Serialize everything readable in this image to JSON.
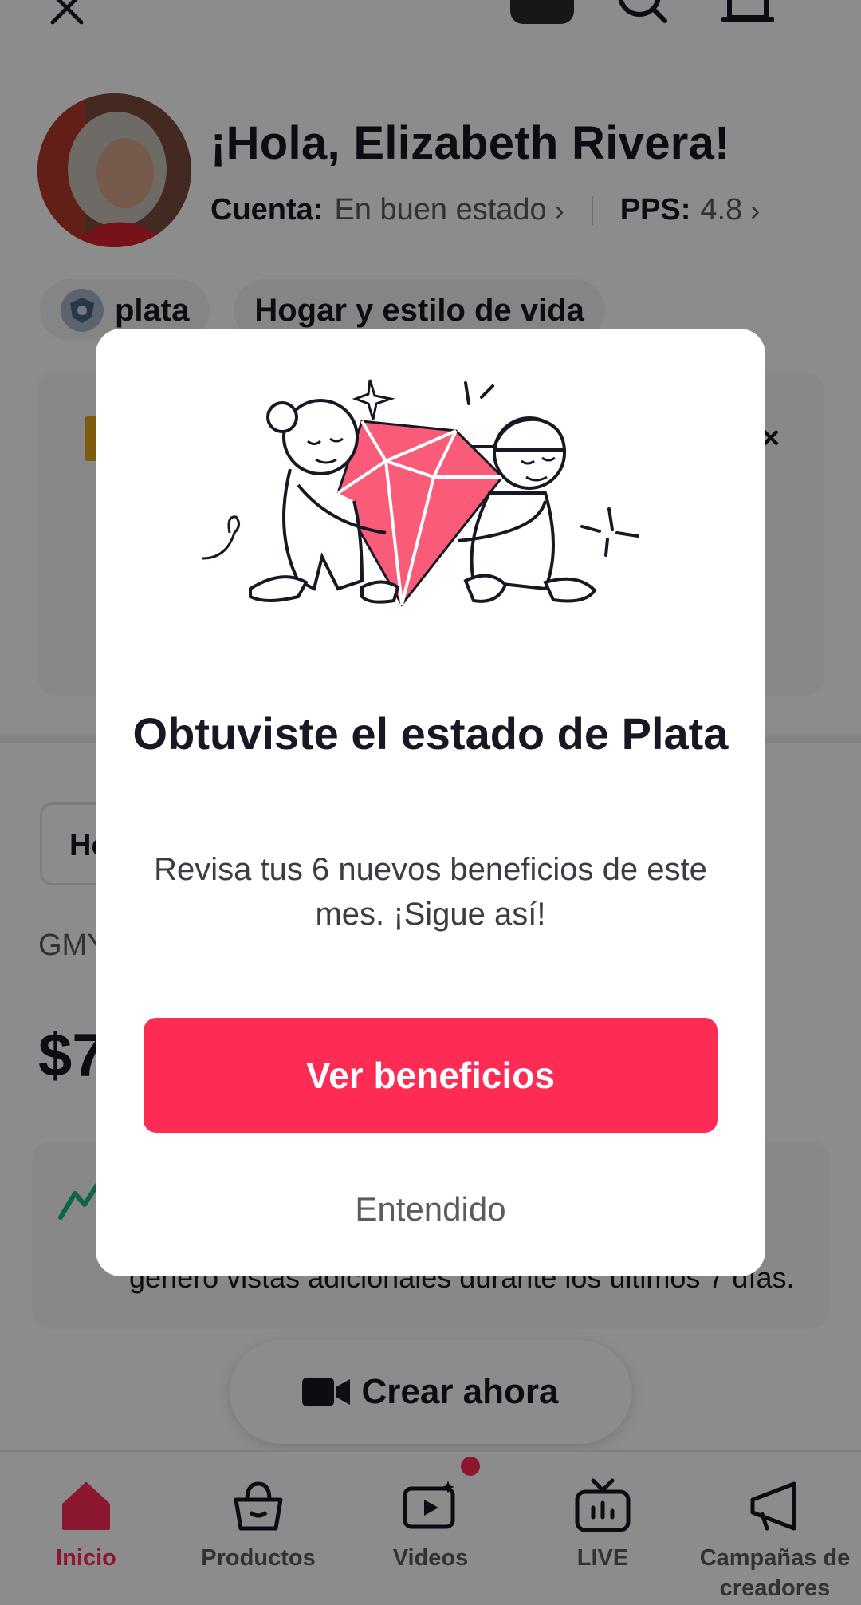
{
  "header": {
    "greeting": "¡Hola, Elizabeth Rivera!",
    "account_label": "Cuenta:",
    "account_value": "En buen estado",
    "pps_label": "PPS:",
    "pps_value": "4.8",
    "chevron": "›"
  },
  "chips": {
    "tier": "plata",
    "category": "Hogar y estilo de vida"
  },
  "card": {
    "close": "×"
  },
  "stats": {
    "period_chip": "Ho",
    "gmv_label": "GMY",
    "gmv_value": "$7"
  },
  "tip": {
    "text": "generó vistas adicionales durante los últimos 7 días."
  },
  "create": {
    "label": "Crear ahora"
  },
  "nav": {
    "items": [
      {
        "label": "Inicio",
        "icon": "home-icon",
        "active": true
      },
      {
        "label": "Productos",
        "icon": "shopping-bag-icon"
      },
      {
        "label": "Videos",
        "icon": "video-sparkle-icon"
      },
      {
        "label": "LIVE",
        "icon": "live-tv-icon"
      },
      {
        "label": "Campañas de creadores",
        "icon": "megaphone-icon"
      }
    ]
  },
  "modal": {
    "title": "Obtuviste el estado de Plata",
    "text": "Revisa tus 6 nuevos beneficios de este mes. ¡Sigue así!",
    "primary_button": "Ver beneficios",
    "secondary_button": "Entendido"
  },
  "colors": {
    "accent": "#fe2c55",
    "gem": "#f95b78",
    "trend": "#1db67a"
  }
}
